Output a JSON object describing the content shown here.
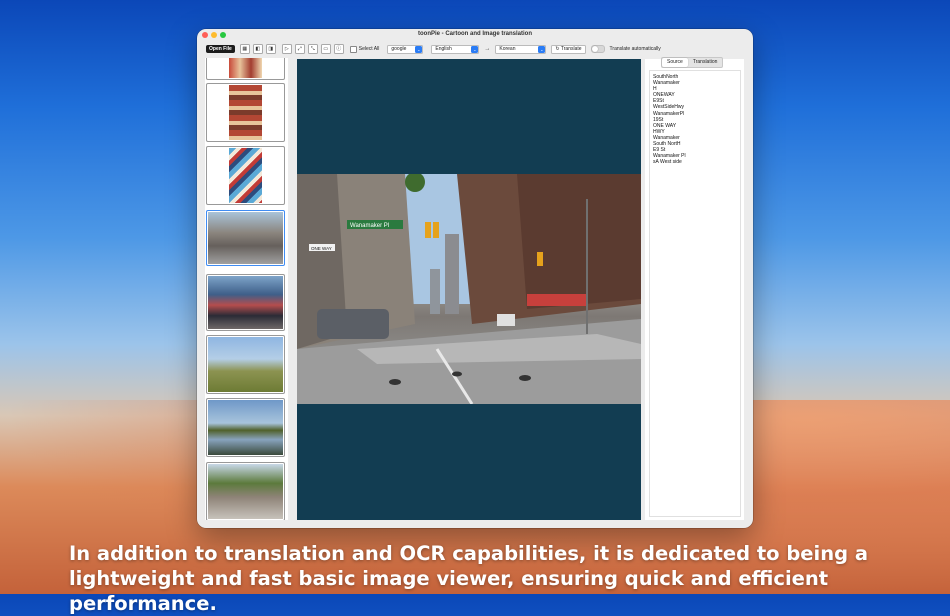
{
  "window": {
    "title": "toonPie - Cartoon and Image translation"
  },
  "toolbar": {
    "open_file": "Open File",
    "tools": [
      {
        "icon": "grid-icon",
        "glyph": "▦"
      },
      {
        "icon": "split-left-icon",
        "glyph": "◧"
      },
      {
        "icon": "split-right-icon",
        "glyph": "◨"
      },
      {
        "icon": "play-icon",
        "glyph": "▷"
      },
      {
        "icon": "expand-icon",
        "glyph": "⤢"
      },
      {
        "icon": "collapse-icon",
        "glyph": "⤡"
      },
      {
        "icon": "fit-width-icon",
        "glyph": "▭"
      },
      {
        "icon": "info-icon",
        "glyph": "ⓘ"
      }
    ],
    "select_all": "Select All",
    "engine": "google",
    "source_lang": "English",
    "arrow": "→",
    "target_lang": "Korean",
    "translate": "Translate",
    "translate_auto": "Translate automatically",
    "translate_icon": "refresh-icon"
  },
  "panel": {
    "tabs": [
      "Source",
      "Translation"
    ],
    "active_tab": "Source",
    "lines": [
      "SouthNorth",
      "Wanamaker",
      "H",
      "ONEWAY",
      "E9St",
      "WestSideHwy",
      "WanamakerPl",
      "19St",
      "ONE WAY",
      "HWY",
      "Wanamaker",
      "South NortH",
      "E9 St",
      "Wanamaker Pl",
      "sA West side"
    ]
  },
  "sign": {
    "street": "Wanamaker Pl",
    "oneway": "ONE WAY"
  },
  "caption": "In addition to translation and OCR capabilities, it is dedicated to being a lightweight and fast basic image viewer, ensuring quick and efficient performance."
}
